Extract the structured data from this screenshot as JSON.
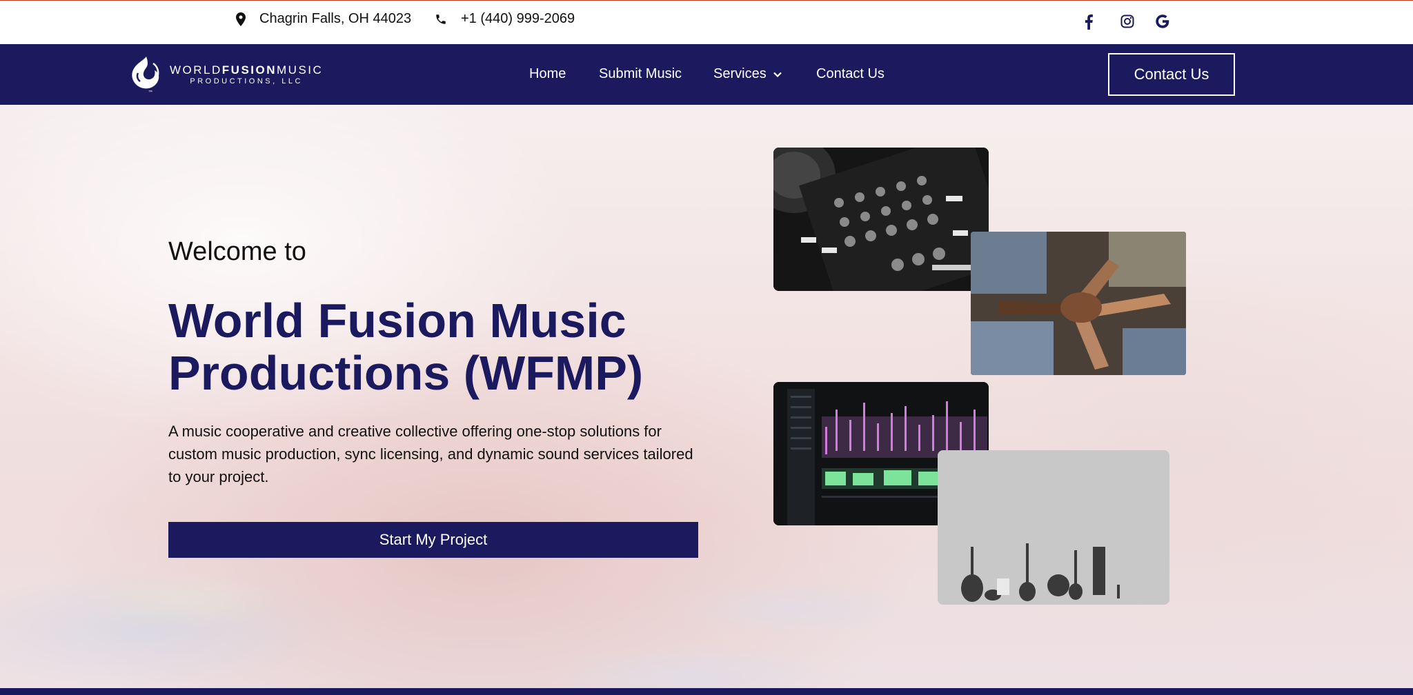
{
  "topbar": {
    "location": "Chagrin Falls, OH 44023",
    "phone": "+1 (440) 999-2069",
    "social_icons": [
      "facebook-icon",
      "instagram-icon",
      "google-icon"
    ]
  },
  "brand": {
    "name_world": "WORLD",
    "name_fusion": "FUSION",
    "name_music": "MUSIC",
    "name_sub": "PRODUCTIONS, LLC",
    "tm": "™"
  },
  "nav": {
    "items": [
      "Home",
      "Submit Music",
      "Services",
      "Contact Us"
    ],
    "cta": "Contact Us"
  },
  "hero": {
    "welcome": "Welcome to",
    "title": "World Fusion Music Productions (WFMP)",
    "description": "A music cooperative and creative collective offering one-stop solutions for custom music production, sync licensing, and dynamic sound services tailored to your project.",
    "cta": "Start My Project"
  },
  "colors": {
    "primary": "#1b1a5e",
    "white": "#ffffff",
    "top_border": "#c0392b"
  }
}
